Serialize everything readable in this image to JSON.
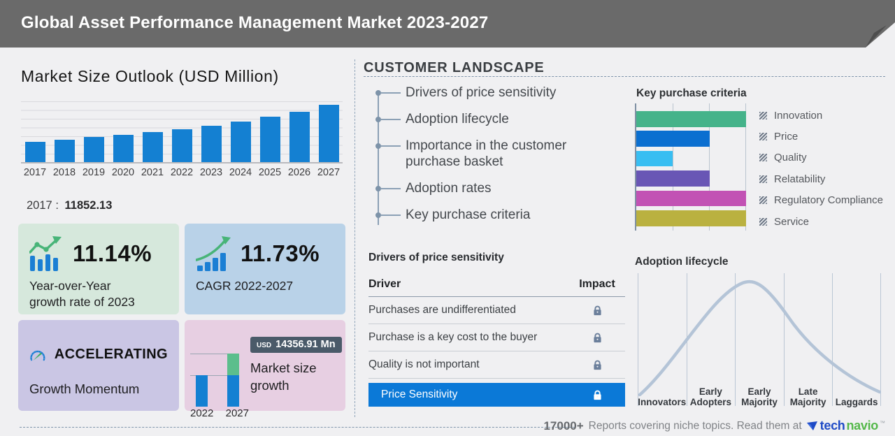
{
  "header": {
    "title": "Global Asset Performance Management Market 2023-2027"
  },
  "left_panel": {
    "chart_title": "Market Size Outlook (USD Million)",
    "base_year": {
      "label": "2017",
      "separator": ":",
      "value": "11852.13"
    },
    "cards": {
      "yoy": {
        "value": "11.14%",
        "lines": [
          "Year-over-Year",
          "growth rate of 2023"
        ]
      },
      "cagr": {
        "value": "11.73%",
        "label": "CAGR 2022-2027"
      },
      "momentum": {
        "status": "ACCELERATING",
        "label": "Growth Momentum"
      },
      "market_growth": {
        "currency": "USD",
        "amount": "14356.91 Mn",
        "lines": [
          "Market size",
          "growth"
        ],
        "start_year": "2022",
        "end_year": "2027"
      }
    }
  },
  "customer_landscape": {
    "title": "CUSTOMER LANDSCAPE",
    "items": [
      "Drivers of price sensitivity",
      "Adoption lifecycle",
      "Importance in the customer purchase basket",
      "Adoption rates",
      "Key purchase criteria"
    ]
  },
  "key_purchase_criteria": {
    "title": "Key purchase criteria"
  },
  "drivers_table": {
    "title": "Drivers of price sensitivity",
    "columns": [
      "Driver",
      "Impact"
    ],
    "rows": [
      "Purchases are undifferentiated",
      "Purchase is a key cost to the buyer",
      "Quality is not important"
    ],
    "highlight_row": "Price Sensitivity"
  },
  "adoption_lifecycle": {
    "title": "Adoption lifecycle",
    "stages": [
      [
        "Innovators"
      ],
      [
        "Early",
        "Adopters"
      ],
      [
        "Early",
        "Majority"
      ],
      [
        "Late",
        "Majority"
      ],
      [
        "Laggards"
      ]
    ]
  },
  "footer": {
    "count": "17000+",
    "text": "Reports covering niche topics. Read them at",
    "brand_tech": "tech",
    "brand_navio": "navio"
  },
  "colors": {
    "header_bg": "#6a6a6a",
    "primary_bar_blue": "#1480d2",
    "increment_green": "#5cbe8c",
    "highlight_row_blue": "#0b79d7",
    "card_green": "#d6e8dc",
    "card_blue": "#b9d2e8",
    "card_purple": "#cac6e4",
    "card_pink": "#e7cfe2",
    "technavio_blue": "#1e4ac6",
    "technavio_green": "#54b84a"
  },
  "chart_data": [
    {
      "id": "market-size-outlook",
      "type": "bar",
      "title": "Market Size Outlook (USD Million)",
      "categories": [
        "2017",
        "2018",
        "2019",
        "2020",
        "2021",
        "2022",
        "2023",
        "2024",
        "2025",
        "2026",
        "2027"
      ],
      "values": [
        11852.13,
        13050,
        14620,
        16080,
        17720,
        19383,
        21542,
        23880,
        26550,
        29780,
        33740
      ],
      "labeled_values": {
        "2017": 11852.13
      },
      "ylabel": "USD Million",
      "bar_color": "#1480d2",
      "grid": true,
      "note": "Only the 2017 value (11852.13) is printed on screen; other values estimated from bar heights."
    },
    {
      "id": "market-size-growth",
      "type": "bar",
      "categories": [
        "2022",
        "2027"
      ],
      "values": [
        19383,
        33740
      ],
      "annotation": "USD 14356.91 Mn",
      "colors": {
        "base": "#1480d2",
        "increment": "#5cbe8c"
      },
      "note": "Badge shows incremental market size growth 2022-2027."
    },
    {
      "id": "key-purchase-criteria",
      "type": "bar",
      "orientation": "horizontal",
      "title": "Key purchase criteria",
      "categories": [
        "Innovation",
        "Price",
        "Quality",
        "Relatability",
        "Regulatory Compliance",
        "Service"
      ],
      "values": [
        3,
        2,
        1,
        2,
        3,
        3
      ],
      "xlim": [
        0,
        3
      ],
      "colors": [
        "#45b38a",
        "#0b6fd0",
        "#38bef2",
        "#6956b5",
        "#c252b4",
        "#bab140"
      ],
      "legend_position": "right",
      "note": "No numeric axis; lengths read against third-interval gridlines."
    },
    {
      "id": "adoption-lifecycle",
      "type": "area",
      "title": "Adoption lifecycle",
      "categories": [
        "Innovators",
        "Early Adopters",
        "Early Majority",
        "Late Majority",
        "Laggards"
      ],
      "shape": "bell curve peaking within Early Majority",
      "curve_color": "#b4c4d7"
    }
  ]
}
